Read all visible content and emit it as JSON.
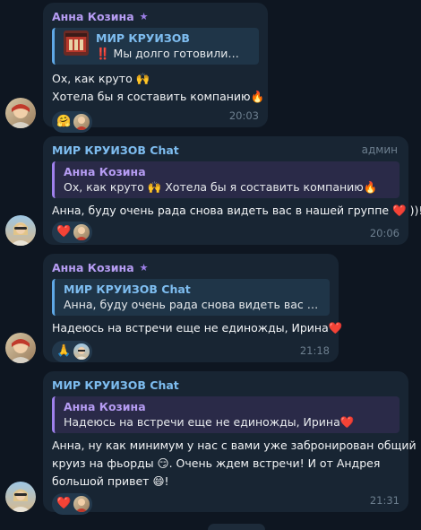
{
  "messages": [
    {
      "sender": "Анна Козина",
      "reply": {
        "name": "МИР КРУИЗОВ",
        "text": "‼️ Мы долго готовились ..."
      },
      "lines": [
        "Ох, как круто 🙌",
        "Хотела бы я составить компанию🔥"
      ],
      "reactions": [
        "🤗"
      ],
      "time": "20:03"
    },
    {
      "sender": "МИР КРУИЗОВ Chat",
      "role": "админ",
      "reply": {
        "name": "Анна Козина",
        "text": "Ох, как круто 🙌 Хотела бы я составить компанию🔥"
      },
      "lines": [
        "Анна, буду очень рада снова видеть вас в нашей группе ❤️ ))!"
      ],
      "reactions": [
        "❤️"
      ],
      "time": "20:06"
    },
    {
      "sender": "Анна Козина",
      "reply": {
        "name": "МИР КРУИЗОВ Chat",
        "text": "Анна, буду очень рада снова видеть вас в на..."
      },
      "lines": [
        "Надеюсь на встречи еще не единожды, Ирина❤️"
      ],
      "reactions": [
        "🙏"
      ],
      "time": "21:18"
    },
    {
      "sender": "МИР КРУИЗОВ Chat",
      "reply": {
        "name": "Анна Козина",
        "text": "Надеюсь на встречи еще не единожды, Ирина❤️"
      },
      "lines": [
        "Анна, ну как минимум у нас с вами уже забронирован общий",
        "круиз на фьорды 😏. Очень ждем встречи! И от Андрея",
        "большой привет 😄!"
      ],
      "reactions": [
        "❤️"
      ],
      "time": "21:31"
    }
  ],
  "colors": {
    "background": "#0e1621",
    "bubble": "#182533",
    "anna": "#b69cf3",
    "mir": "#7ebdf0"
  }
}
